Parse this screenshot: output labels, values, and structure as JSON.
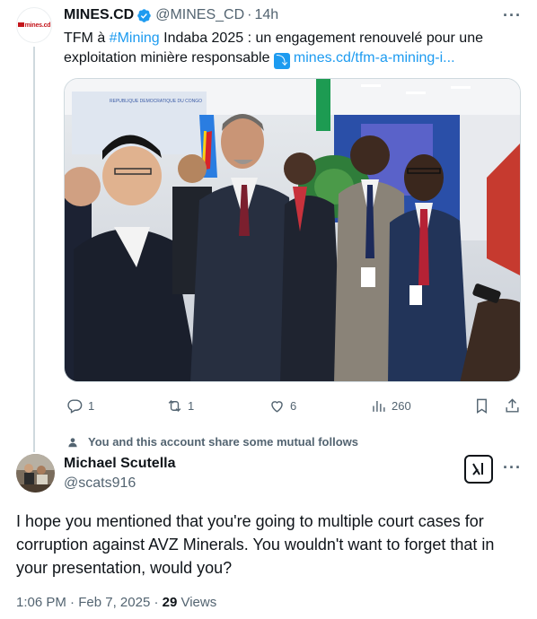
{
  "tweet": {
    "author_name": "MINES.CD",
    "handle": "@MINES_CD",
    "time": "14h",
    "avatar_logo": "mines.cd",
    "text_part1": "TFM à ",
    "hashtag": "#Mining",
    "text_part2": " Indaba 2025 : un engagement renouvelé pour une",
    "text_line2": "exploitation minière responsable",
    "arrow_emoji": "⤵",
    "link": "mines.cd/tfm-a-mining-i...",
    "banner_text": "REPUBLIQUE DEMOCRATIQUE DU CONGO",
    "actions": {
      "replies": "1",
      "retweets": "1",
      "likes": "6",
      "views": "260"
    }
  },
  "mutual_note": "You and this account share some mutual follows",
  "reply": {
    "author_name": "Michael Scutella",
    "handle": "@scats916",
    "text": "I hope you mentioned that you're going to multiple court cases for corruption against AVZ Minerals. You wouldn't want to forget that in your presentation, would you?",
    "time": "1:06 PM",
    "date": "Feb 7, 2025",
    "views_count": "29",
    "views_label": "Views"
  },
  "more_label": "···",
  "colors": {
    "accent": "#1d9bf0",
    "muted": "#536471",
    "text": "#0f1419"
  },
  "icons": [
    "verified-badge-icon",
    "more-icon",
    "reply-icon",
    "retweet-icon",
    "like-icon",
    "views-icon",
    "bookmark-icon",
    "share-icon",
    "person-icon",
    "grok-icon"
  ]
}
